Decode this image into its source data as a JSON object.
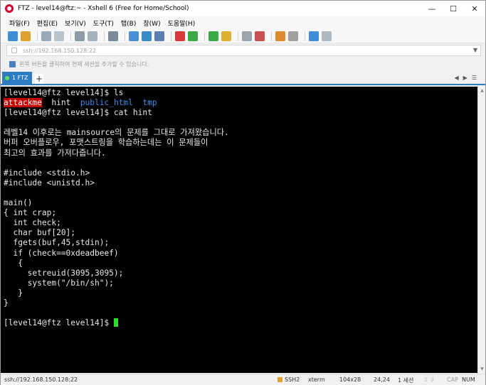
{
  "window": {
    "title": "FTZ - level14@ftz:~ - Xshell 6 (Free for Home/School)"
  },
  "menu": [
    "파일(F)",
    "편집(E)",
    "보기(V)",
    "도구(T)",
    "탭(B)",
    "창(W)",
    "도움말(H)"
  ],
  "address": {
    "value": "ssh://192.168.150.128:22"
  },
  "hint": {
    "text": "왼쪽 버튼을 클릭하여 현재 세션을 추가할 수 있습니다."
  },
  "tabs": [
    {
      "label": "1 FTZ",
      "active": true
    }
  ],
  "terminal": {
    "prompt1": "[level14@ftz level14]$ ls",
    "ls_items": [
      "attackme",
      "hint",
      "public_html",
      "tmp"
    ],
    "prompt2": "[level14@ftz level14]$ cat hint",
    "hint_lines": [
      "레벨14 이후로는 mainsource의 문제를 그대로 가져왔습니다.",
      "버퍼 오버플로우, 포맷스트링을 학습하는데는 이 문제들이",
      "최고의 효과를 가져다줍니다."
    ],
    "code_lines": [
      "#include <stdio.h>",
      "#include <unistd.h>",
      "",
      "main()",
      "{ int crap;",
      "  int check;",
      "  char buf[20];",
      "  fgets(buf,45,stdin);",
      "  if (check==0xdeadbeef)",
      "   {",
      "     setreuid(3095,3095);",
      "     system(\"/bin/sh\");",
      "   }",
      "}"
    ],
    "prompt3": "[level14@ftz level14]$ "
  },
  "status": {
    "address": "ssh://192.168.150.128:22",
    "protocol": "SSH2",
    "term": "xterm",
    "size": "104x28",
    "cursor": "24,24",
    "sessions": "1 세션",
    "caps": "CAP",
    "num": "NUM"
  },
  "colors": {
    "accent": "#2d7cc1",
    "cursor": "#2de22d",
    "dir": "#3b8eea",
    "exec_bg": "#c40000"
  }
}
